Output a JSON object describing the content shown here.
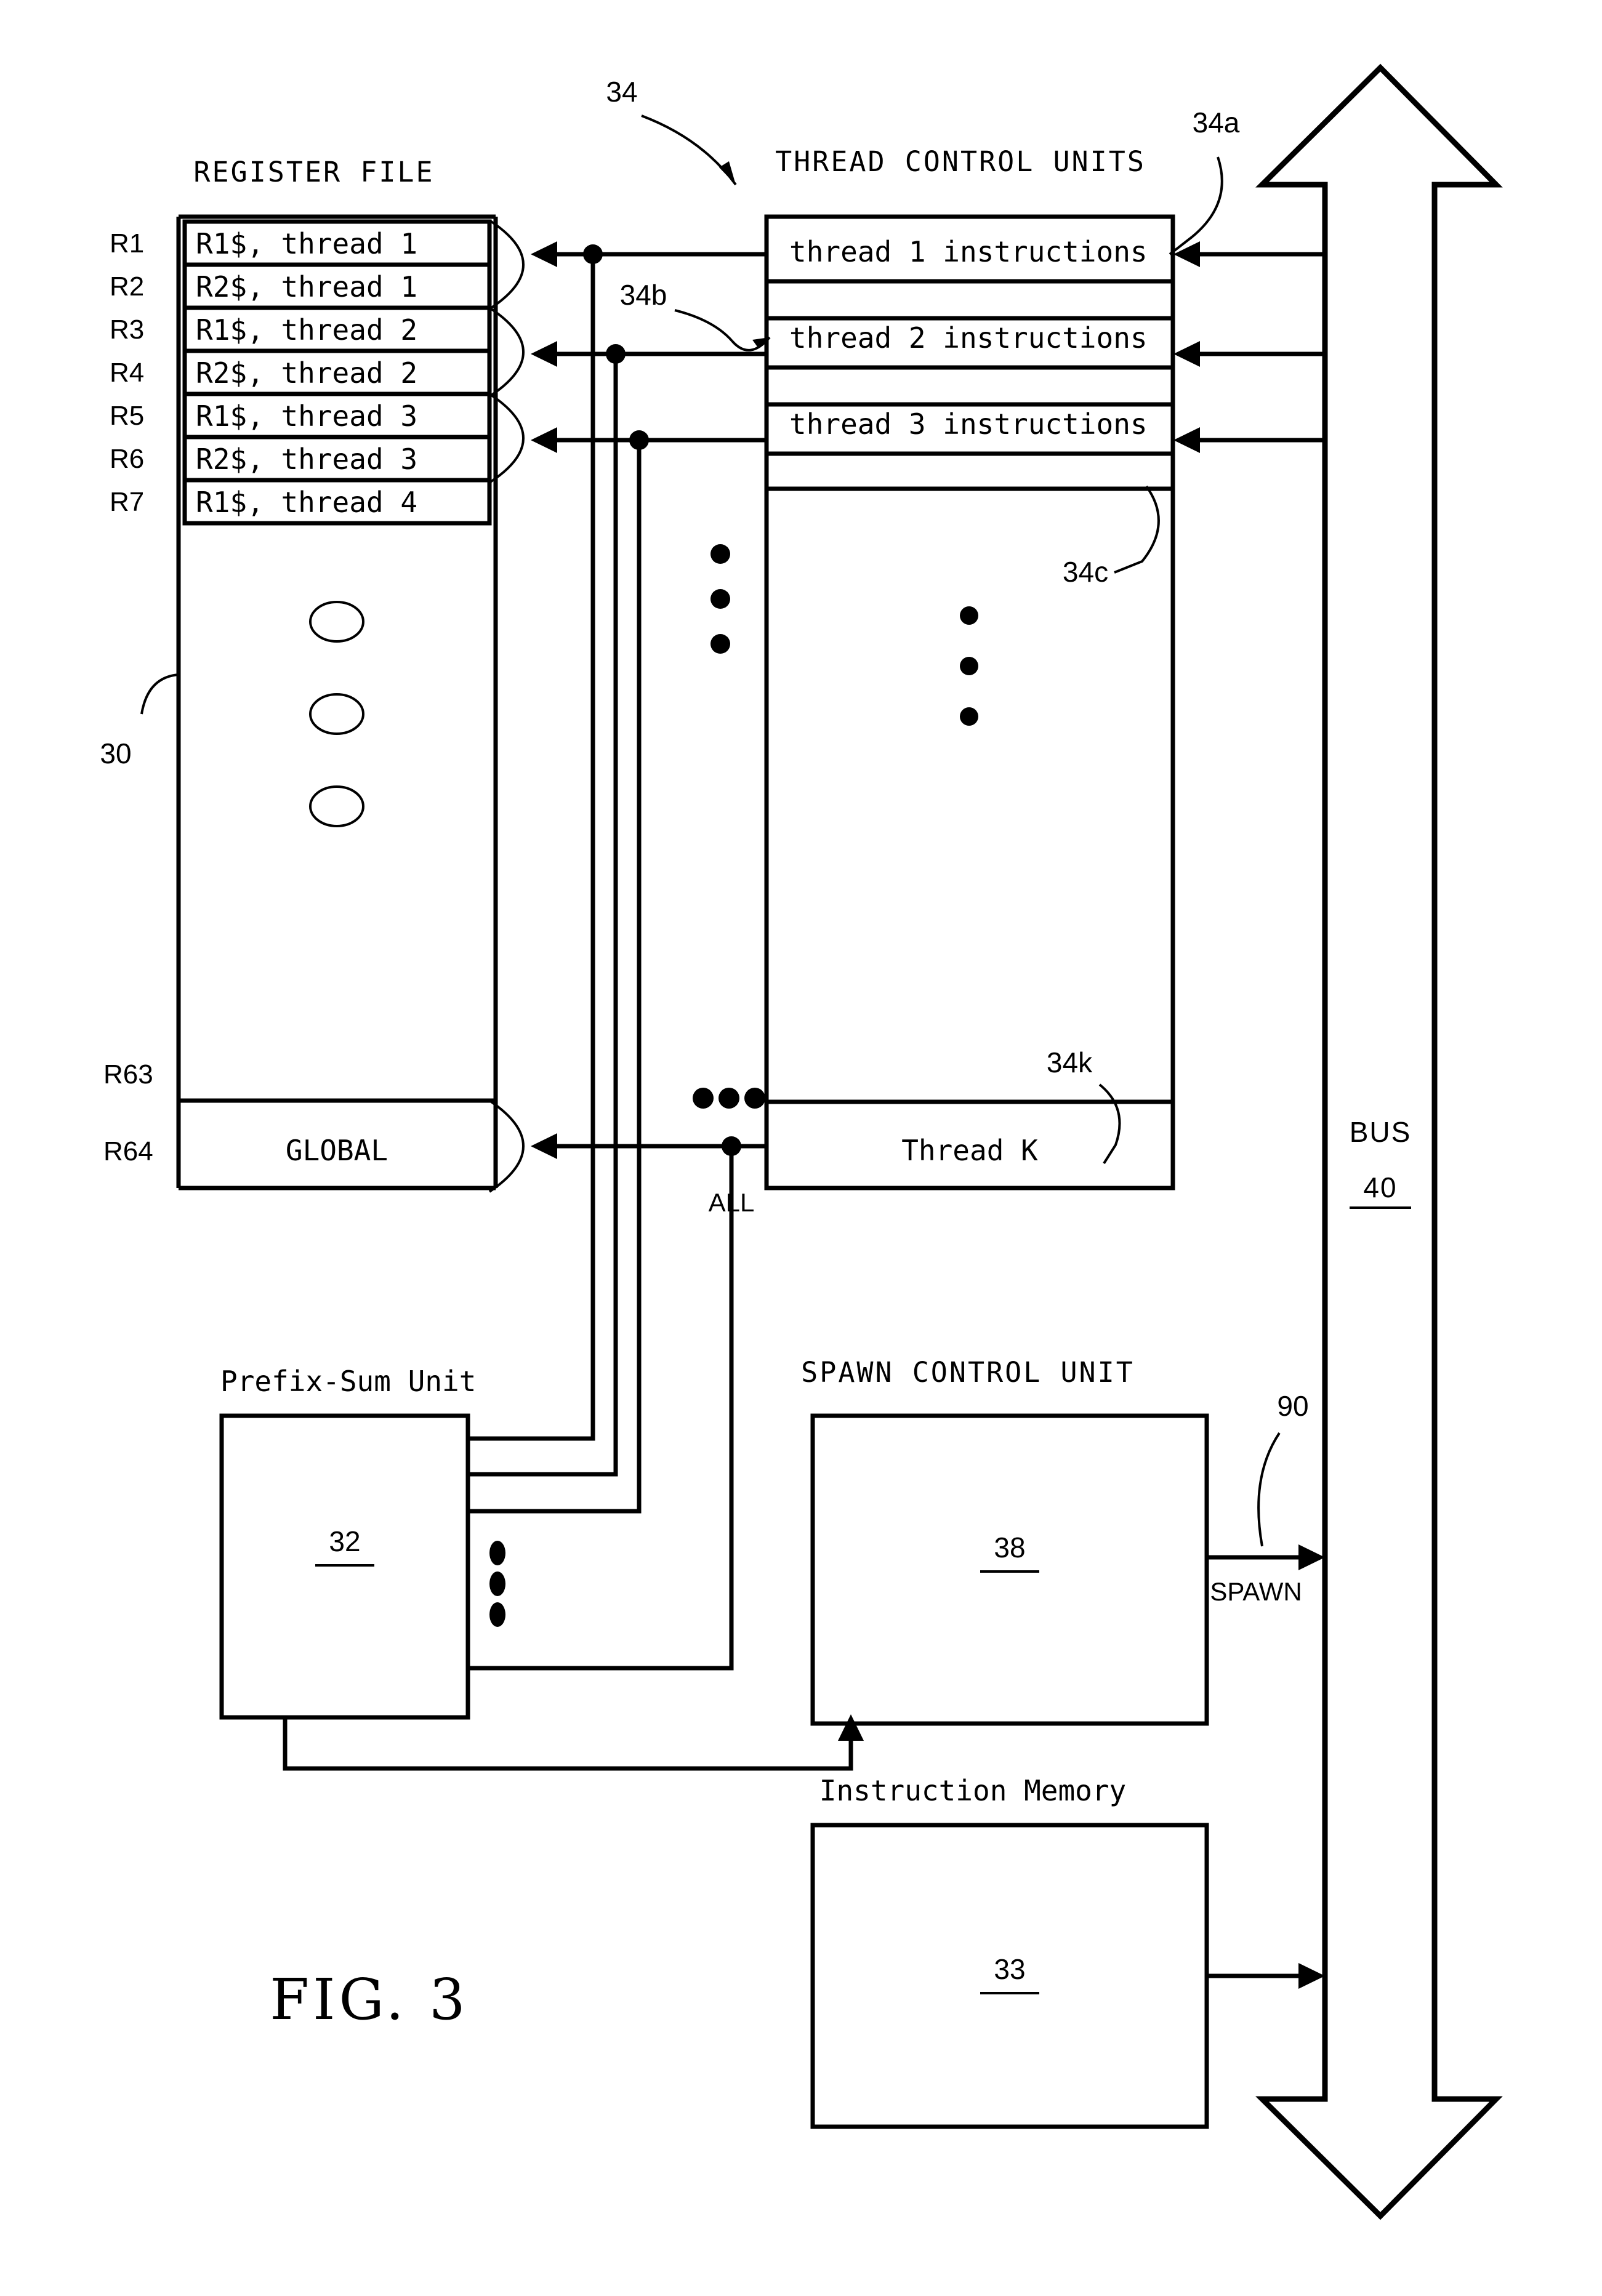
{
  "figure": {
    "label": "FIG. 3",
    "domain_note": "patent block diagram"
  },
  "register_file": {
    "title": "REGISTER FILE",
    "ref": "30",
    "row_labels": [
      "R1",
      "R2",
      "R3",
      "R4",
      "R5",
      "R6",
      "R7"
    ],
    "rows": [
      "R1$, thread 1",
      "R2$, thread 1",
      "R1$, thread 2",
      "R2$, thread 2",
      "R1$, thread 3",
      "R2$, thread 3",
      "R1$, thread 4"
    ],
    "bottom_label_upper": "R63",
    "bottom_label_lower": "R64",
    "global_cell": "GLOBAL",
    "vertical_ellipsis": "⋮"
  },
  "thread_control_units": {
    "title": "THREAD CONTROL UNITS",
    "ref": "34",
    "rows": [
      {
        "label": "thread 1 instructions",
        "ref": "34a"
      },
      {
        "label": "thread 2 instructions",
        "ref": "34b"
      },
      {
        "label": "thread 3 instructions",
        "ref": "34c"
      }
    ],
    "last_row": {
      "label": "Thread K",
      "ref": "34k"
    },
    "vertical_ellipsis": "⋮"
  },
  "bus": {
    "label": "BUS",
    "ref": "40"
  },
  "signals": {
    "all_label": "ALL",
    "spawn_label": "SPAWN",
    "spawn_ref": "90",
    "horizontal_ellipsis": "•••"
  },
  "prefix_sum_unit": {
    "title": "Prefix-Sum Unit",
    "ref": "32"
  },
  "spawn_control_unit": {
    "title": "SPAWN CONTROL UNIT",
    "ref": "38"
  },
  "instruction_memory": {
    "title": "Instruction Memory",
    "ref": "33"
  },
  "colors": {
    "ink": "#000000",
    "paper": "#ffffff"
  }
}
